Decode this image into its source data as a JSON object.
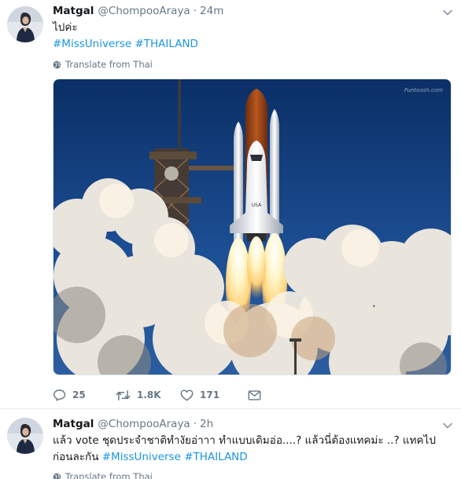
{
  "tweets": [
    {
      "name": "Matgal",
      "handle": "@ChompooAraya",
      "separator": "·",
      "time": "24m",
      "text": "ไปค่ะ",
      "hashtags": [
        "#MissUniverse",
        "#THAILAND"
      ],
      "translate_label": "Translate from Thai",
      "media": {
        "watermark": "Funtoosh.com",
        "subject": "space-shuttle-launch-photo"
      },
      "actions": {
        "replies": "25",
        "retweets": "1.8K",
        "likes": "171"
      }
    },
    {
      "name": "Matgal",
      "handle": "@ChompooAraya",
      "separator": "·",
      "time": "2h",
      "text": "แล้ว vote ชุดประจำชาติทำงัยอ่าาา ทำแบบเดิมอ่อ....? แล้วนี่ต้องแทคม่ะ ..? แทคไปก่อนละกัน",
      "hashtags": [
        "#MissUniverse",
        "#THAILAND"
      ],
      "translate_label": "Translate from Thai"
    }
  ],
  "icons": {
    "caret": "chevron-down-icon",
    "globe": "globe-icon",
    "reply": "reply-icon",
    "retweet": "retweet-icon",
    "like": "heart-icon",
    "dm": "envelope-icon"
  },
  "colors": {
    "text": "#14171a",
    "muted": "#657786",
    "link": "#1b95e0",
    "border": "#e6ecf0"
  }
}
